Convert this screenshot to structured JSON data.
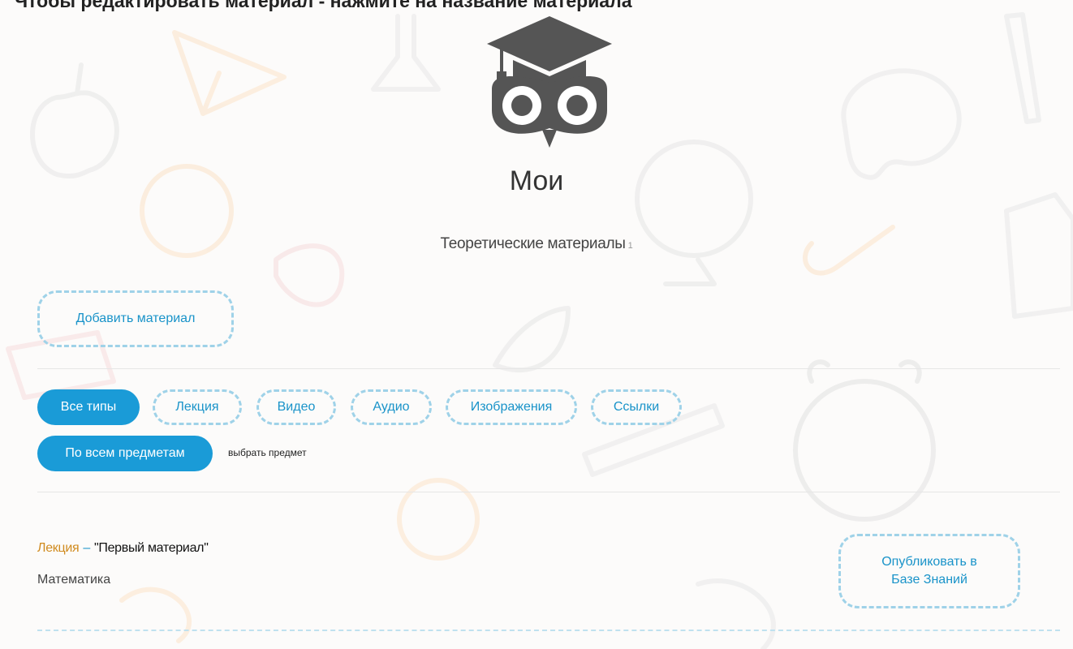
{
  "banner": "Чтобы редактировать материал - нажмите на название материала",
  "page": {
    "title": "Мои",
    "subtitle": "Теоретические материалы",
    "subtitle_count": "1"
  },
  "actions": {
    "add_material": "Добавить материал"
  },
  "type_filters": [
    {
      "label": "Все типы",
      "active": true
    },
    {
      "label": "Лекция",
      "active": false
    },
    {
      "label": "Видео",
      "active": false
    },
    {
      "label": "Аудио",
      "active": false
    },
    {
      "label": "Изображения",
      "active": false
    },
    {
      "label": "Ссылки",
      "active": false
    }
  ],
  "subject_filter": {
    "label": "По всем предметам",
    "select_link": "выбрать предмет"
  },
  "materials": [
    {
      "type": "Лекция",
      "separator": "–",
      "title": "\"Первый материал\"",
      "subject": "Математика",
      "publish_button": "Опубликовать в Базе Знаний"
    }
  ],
  "icons": {
    "logo": "owl-graduation-cap-icon"
  },
  "colors": {
    "accent": "#1a9bd7",
    "dash_border": "#9fd2e8",
    "type_label": "#d08b1f",
    "logo": "#555555"
  }
}
